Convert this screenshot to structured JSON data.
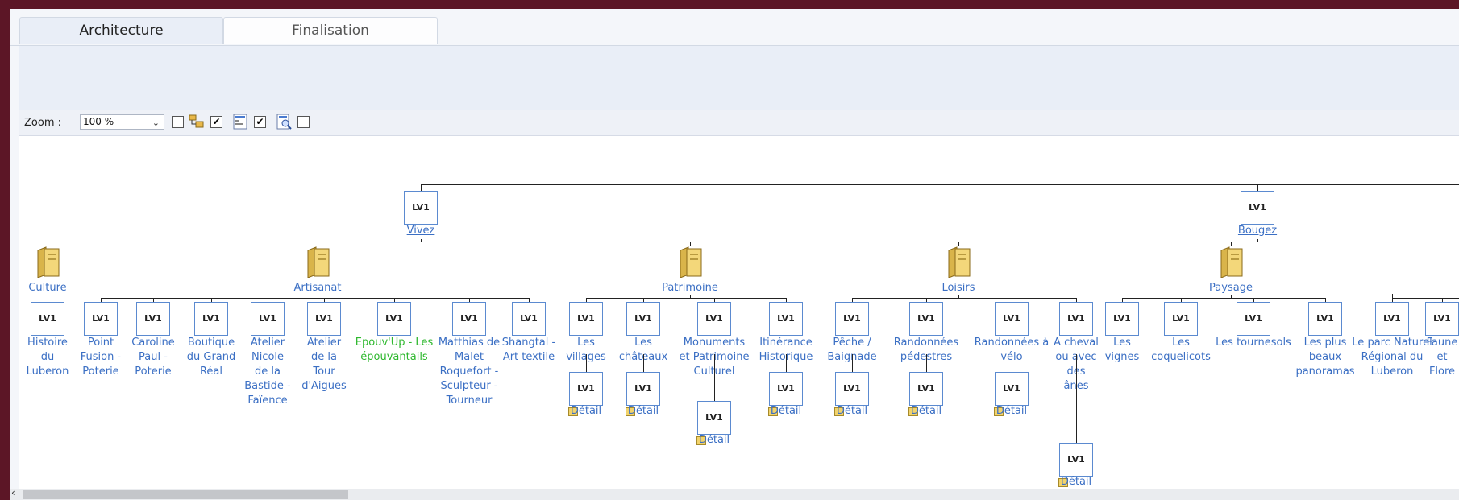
{
  "tabs": {
    "architecture": "Architecture",
    "finalisation": "Finalisation"
  },
  "toolbar": {
    "zoom_label": "Zoom :",
    "zoom_value": "100 %",
    "cb1": "",
    "cb2": "✔",
    "cb3": "✔",
    "cb4": ""
  },
  "tree": {
    "node_label": "LV1",
    "vivez": "Vivez",
    "bougez": "Bougez",
    "culture": "Culture",
    "artisanat": "Artisanat",
    "patrimoine": "Patrimoine",
    "loisirs": "Loisirs",
    "paysage": "Paysage",
    "detail": "Détail",
    "culture_items": [
      "Histoire du Luberon"
    ],
    "artisanat_items": [
      "Point Fusion - Poterie",
      "Caroline Paul - Poterie",
      "Boutique du Grand Réal",
      "Atelier Nicole de la Bastide - Faïence",
      "Atelier de la Tour d'Aigues",
      "Epouv'Up - Les épouvantails",
      "Matthias de Malet Roquefort - Sculpteur - Tourneur",
      "Shangtal - Art textile"
    ],
    "patrimoine_items": [
      "Les villages",
      "Les châteaux",
      "Monuments et Patrimoine Culturel",
      "Itinérance Historique"
    ],
    "loisirs_items": [
      "Pêche / Baignade",
      "Randonnées pédestres",
      "Randonnées à vélo",
      "A cheval ou avec des ânes"
    ],
    "paysage_items": [
      "Les vignes",
      "Les coquelicots",
      "Les tournesols",
      "Les plus beaux panoramas"
    ],
    "nature_items": [
      "Le parc Naturel Régional du Luberon",
      "Faune et Flore"
    ]
  },
  "colors": {
    "link": "#3b6fc4",
    "highlight": "#2eb82e",
    "border": "#5b8ad0"
  }
}
